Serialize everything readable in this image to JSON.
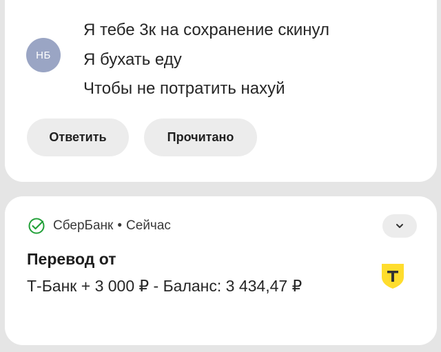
{
  "message_notification": {
    "avatar_initials": "НБ",
    "avatar_color": "#9aa5c4",
    "lines": [
      "Я тебе 3к на сохранение скинул",
      "Я бухать еду",
      "Чтобы не потратить нахуй"
    ],
    "actions": {
      "reply_label": "Ответить",
      "mark_read_label": "Прочитано"
    }
  },
  "sber_notification": {
    "app_name": "СберБанк",
    "separator": "•",
    "time": "Сейчас",
    "title": "Перевод от",
    "body": "Т-Банк + 3 000 ₽ - Баланс: 3 434,47 ₽",
    "app_icon": "sber-check-icon",
    "expand_icon": "chevron-down-icon",
    "large_icon": "tbank-shield-icon",
    "sber_color": "#21a038",
    "tbank_color": "#ffdd2d"
  }
}
